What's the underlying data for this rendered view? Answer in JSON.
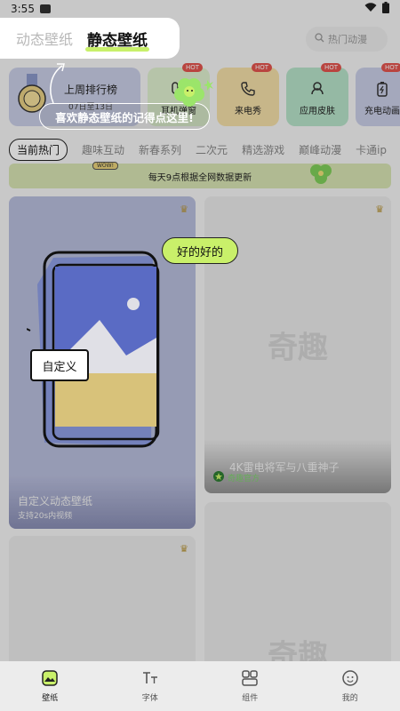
{
  "status": {
    "time": "3:55"
  },
  "header": {
    "tab_dynamic": "动态壁纸",
    "tab_static": "静态壁纸",
    "search_placeholder": "热门动漫"
  },
  "feature_cards": {
    "weekly": {
      "title": "上周排行榜",
      "date": "07日至13日"
    },
    "earphone": {
      "label": "耳机弹窗",
      "badge": "HOT"
    },
    "ringtone": {
      "label": "来电秀",
      "badge": "HOT"
    },
    "skin": {
      "label": "应用皮肤",
      "badge": "HOT"
    },
    "charge": {
      "label": "充电动画",
      "badge": "HOT"
    }
  },
  "categories": [
    "当前热门",
    "趣味互动",
    "新春系列",
    "二次元",
    "精选游戏",
    "巅峰动漫",
    "卡通ip"
  ],
  "banner": {
    "badge": "WOW!",
    "text": "每天9点根据全网数据更新"
  },
  "tutorial": {
    "bubble_text": "喜欢静态壁纸的记得点这里!"
  },
  "wallpapers": {
    "card_a": {
      "title": "自定义动态壁纸",
      "subtitle": "支持20s内视频",
      "tip": "好的好的",
      "tag": "自定义"
    },
    "card_b": {
      "watermark": "奇趣",
      "title": "4K雷电将军与八重神子",
      "author": "奇趣官方"
    },
    "card_c": {
      "watermark": "奇趣"
    }
  },
  "bottom_nav": {
    "wallpaper": "壁纸",
    "font": "字体",
    "widget": "组件",
    "me": "我的"
  },
  "colors": {
    "accent_green": "#c9f06a",
    "hot_red": "#e2544e",
    "crown_gold": "#b8953a"
  }
}
